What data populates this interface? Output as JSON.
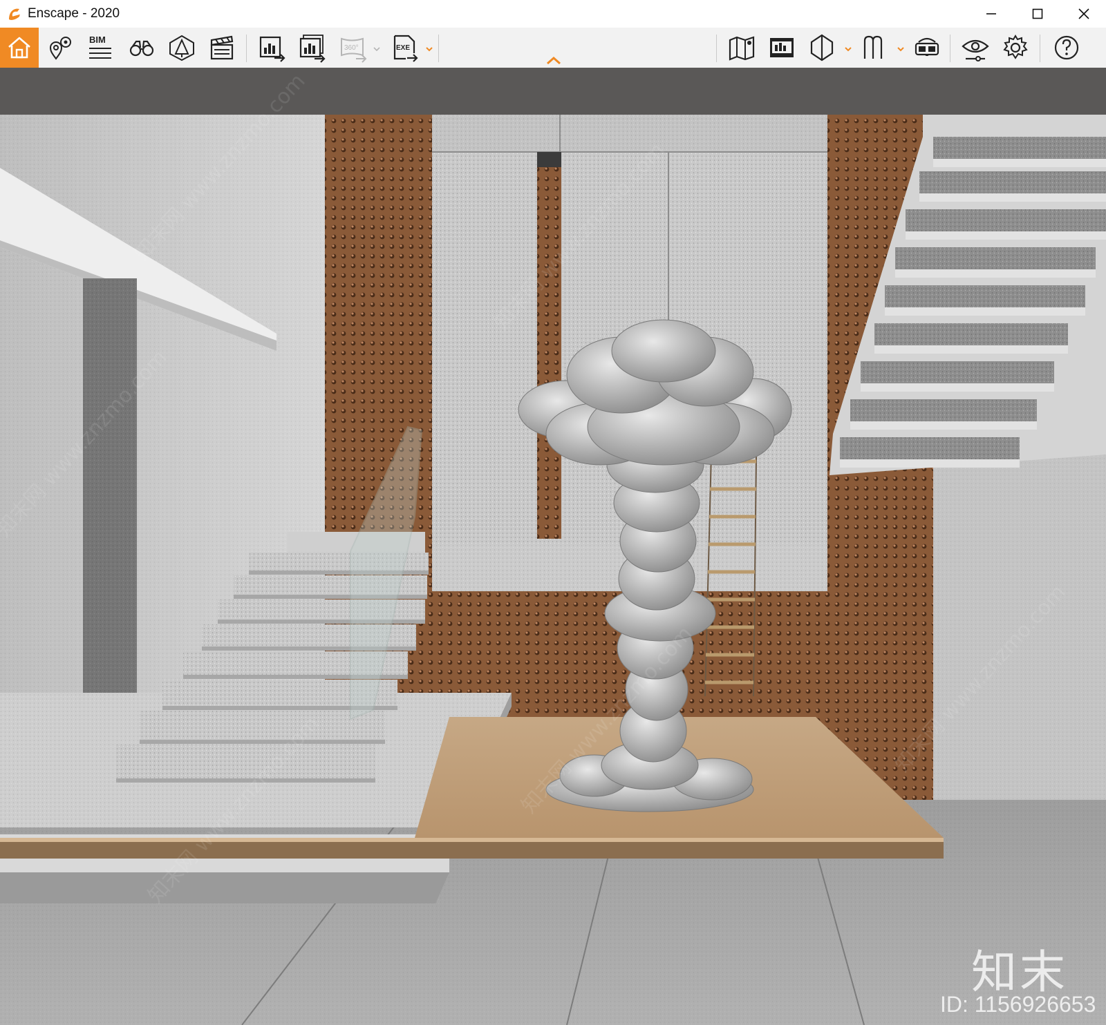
{
  "window": {
    "title": "Enscape - 2020",
    "controls": [
      "minimize",
      "maximize",
      "close"
    ]
  },
  "toolbar": {
    "groups": [
      {
        "items": [
          {
            "icon": "home-icon",
            "active": true
          },
          {
            "icon": "view-management-icon"
          },
          {
            "icon": "bim-icon",
            "label": "BIM"
          },
          {
            "icon": "binoculars-icon"
          },
          {
            "icon": "atmosphere-icon"
          },
          {
            "icon": "clapperboard-icon"
          }
        ]
      },
      {
        "items": [
          {
            "icon": "render-image-icon"
          },
          {
            "icon": "batch-render-icon"
          },
          {
            "icon": "panorama-icon",
            "label": "360°",
            "disabled": true
          },
          {
            "icon": "export-exe-icon",
            "label": "EXE"
          }
        ]
      },
      {
        "items": [
          {
            "icon": "map-icon"
          },
          {
            "icon": "asset-library-icon"
          },
          {
            "icon": "section-box-icon"
          },
          {
            "icon": "materials-icon"
          },
          {
            "icon": "vr-headset-icon"
          }
        ]
      },
      {
        "items": [
          {
            "icon": "eye-visual-settings-icon"
          },
          {
            "icon": "gear-icon"
          }
        ]
      },
      {
        "items": [
          {
            "icon": "help-icon"
          }
        ]
      }
    ],
    "accent_color": "#f08a24"
  },
  "viewport": {
    "watermark_brand": "知末",
    "watermark_id": "ID: 1156926653",
    "faint_watermark": "知末网 www.znzmo.com"
  }
}
